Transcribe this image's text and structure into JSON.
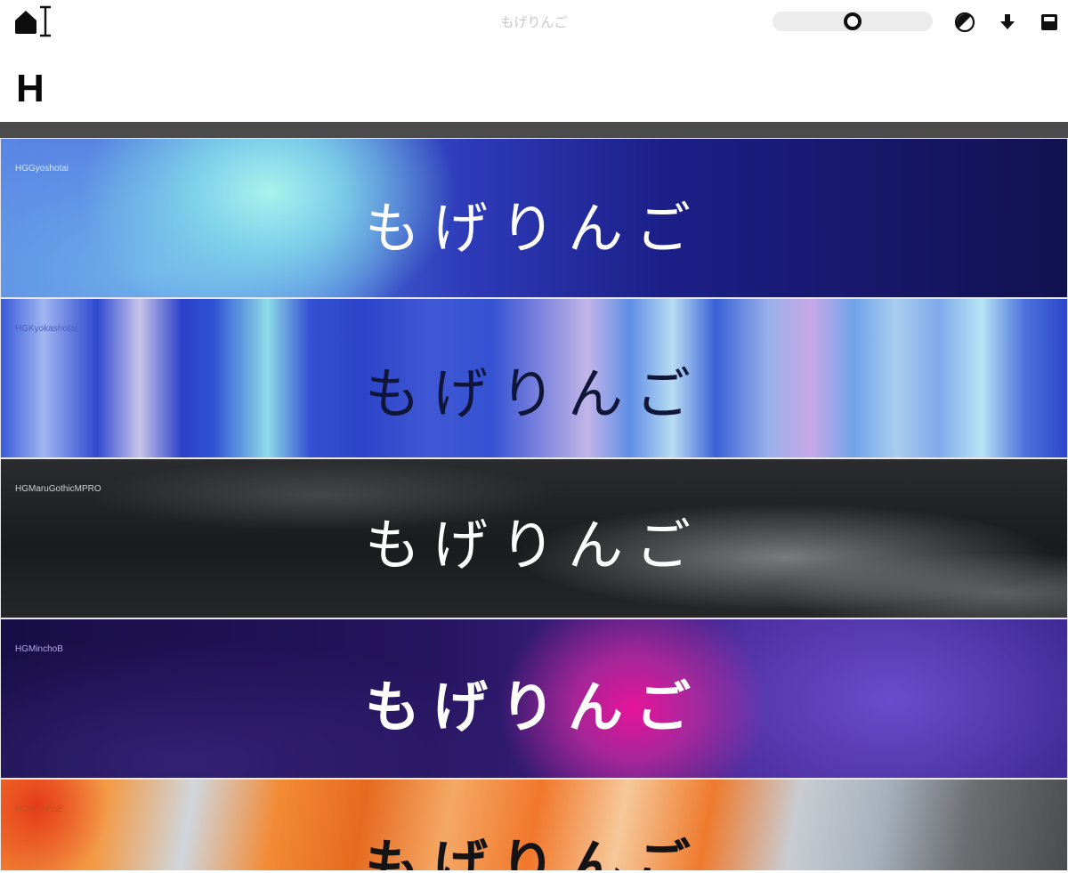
{
  "toolbar": {
    "preview_text": "もげりんご",
    "size_slider": {
      "value_fraction": 0.5
    },
    "icons": [
      "home-icon",
      "text-cursor-icon",
      "contrast-icon",
      "download-icon",
      "layout-icon"
    ]
  },
  "page": {
    "heading": "H"
  },
  "fonts": [
    {
      "name": "HGGyoshotai",
      "sample": "もげりんご"
    },
    {
      "name": "HGKyokashotai",
      "sample": "もげりんご"
    },
    {
      "name": "HGMaruGothicMPRO",
      "sample": "もげりんご"
    },
    {
      "name": "HGMinchoB",
      "sample": "もげりんご"
    },
    {
      "name": "HGMinchoE",
      "sample": "もげりんご"
    }
  ],
  "colors": {
    "divider": "#4b4b4b",
    "icon": "#111111"
  }
}
